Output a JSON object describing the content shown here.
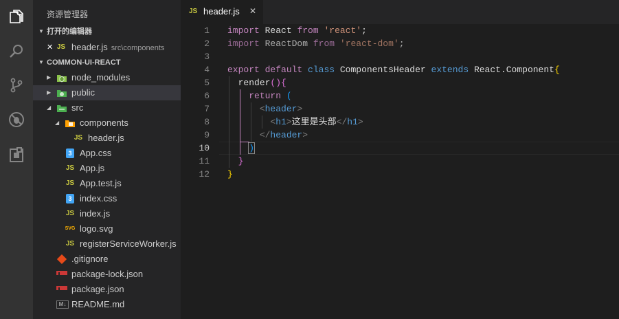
{
  "activity_bar": {
    "icons": [
      "files-icon",
      "search-icon",
      "source-control-icon",
      "debug-icon",
      "extensions-icon"
    ]
  },
  "sidebar": {
    "title": "资源管理器",
    "open_editors": {
      "header": "打开的编辑器",
      "items": [
        {
          "close": "✕",
          "icon": "JS",
          "label": "header.js",
          "desc": "src\\components"
        }
      ]
    },
    "project": {
      "header": "COMMON-UI-REACT",
      "items": [
        {
          "label": "node_modules",
          "icon": "folder-node-icon",
          "twisty": "▶"
        },
        {
          "label": "public",
          "icon": "folder-public-icon",
          "twisty": "▶"
        },
        {
          "label": "src",
          "icon": "folder-src-icon",
          "twisty": "◢"
        },
        {
          "label": "components",
          "icon": "folder-components-icon",
          "twisty": "◢"
        },
        {
          "label": "header.js",
          "icon": "JS"
        },
        {
          "label": "App.css",
          "icon": "3"
        },
        {
          "label": "App.js",
          "icon": "JS"
        },
        {
          "label": "App.test.js",
          "icon": "JS"
        },
        {
          "label": "index.css",
          "icon": "3"
        },
        {
          "label": "index.js",
          "icon": "JS"
        },
        {
          "label": "logo.svg",
          "icon": "SVG"
        },
        {
          "label": "registerServiceWorker.js",
          "icon": "JS"
        },
        {
          "label": ".gitignore",
          "icon": "git-icon"
        },
        {
          "label": "package-lock.json",
          "icon": "npm-icon"
        },
        {
          "label": "package.json",
          "icon": "npm-icon"
        },
        {
          "label": "README.md",
          "icon": "M↓"
        }
      ]
    }
  },
  "tab": {
    "icon": "JS",
    "label": "header.js",
    "close": "✕"
  },
  "editor": {
    "line_numbers": [
      "1",
      "2",
      "3",
      "4",
      "5",
      "6",
      "7",
      "8",
      "9",
      "10",
      "11",
      "12"
    ],
    "active_line": "10",
    "lines": {
      "l1": {
        "kw": "import",
        "id": "React",
        "from": "from",
        "str": "'react'",
        "end": ";"
      },
      "l2": {
        "kw": "import",
        "id": "ReactDom",
        "from": "from",
        "str": "'react-dom'",
        "end": ";"
      },
      "l4": {
        "export": "export",
        "default": "default",
        "class": "class",
        "name": "ComponentsHeader",
        "extends": "extends",
        "base": "React.Component",
        "brace": "{"
      },
      "l5": {
        "fn": "render",
        "parens": "()",
        "brace": "{"
      },
      "l6": {
        "ret": "return",
        "paren": "("
      },
      "l7": {
        "lt": "<",
        "tag": "header",
        "gt": ">"
      },
      "l8": {
        "lt": "<",
        "tag": "h1",
        "gt": ">",
        "text": "这里是头部",
        "close_lt": "</",
        "close_tag": "h1",
        "close_gt": ">"
      },
      "l9": {
        "lt": "</",
        "tag": "header",
        "gt": ">"
      },
      "l10": {
        "paren": ")"
      },
      "l11": {
        "brace": "}"
      },
      "l12": {
        "brace": "}"
      }
    }
  }
}
